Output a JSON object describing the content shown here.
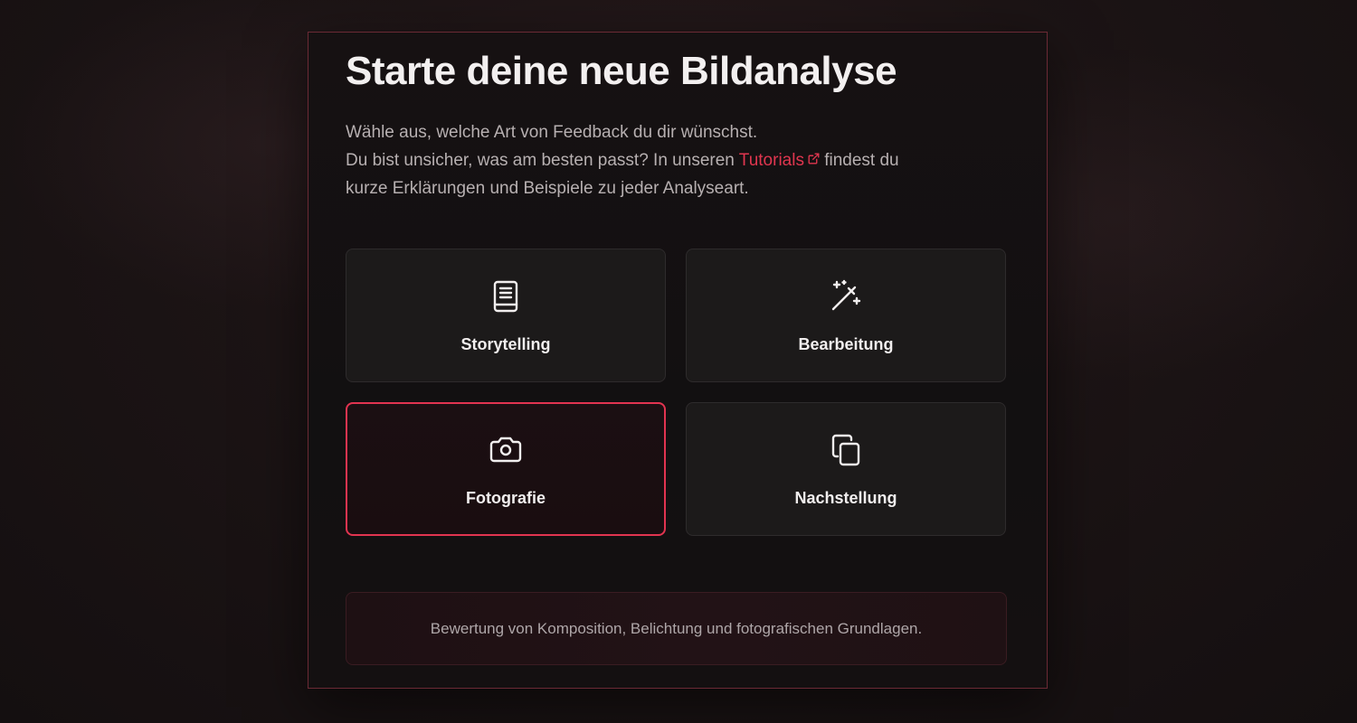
{
  "heading": {
    "title": "Starte deine neue Bildanalyse"
  },
  "intro": {
    "line1": "Wähle aus, welche Art von Feedback du dir wünschst.",
    "line2_before": "Du bist unsicher, was am besten passt? In unseren ",
    "link_text": "Tutorials",
    "line2_after": " findest du",
    "line3": "kurze Erklärungen und Beispiele zu jeder Analyseart."
  },
  "options": [
    {
      "label": "Storytelling",
      "icon": "book-icon",
      "selected": false
    },
    {
      "label": "Bearbeitung",
      "icon": "magic-wand-icon",
      "selected": false
    },
    {
      "label": "Fotografie",
      "icon": "camera-icon",
      "selected": true
    },
    {
      "label": "Nachstellung",
      "icon": "copy-icon",
      "selected": false
    }
  ],
  "description": {
    "text": "Bewertung von Komposition, Belichtung und fotografischen Grundlagen."
  },
  "colors": {
    "accent": "#e23450",
    "link": "#e0364f",
    "card_background": "#1c1a1a",
    "panel_border": "#6b2a35"
  }
}
